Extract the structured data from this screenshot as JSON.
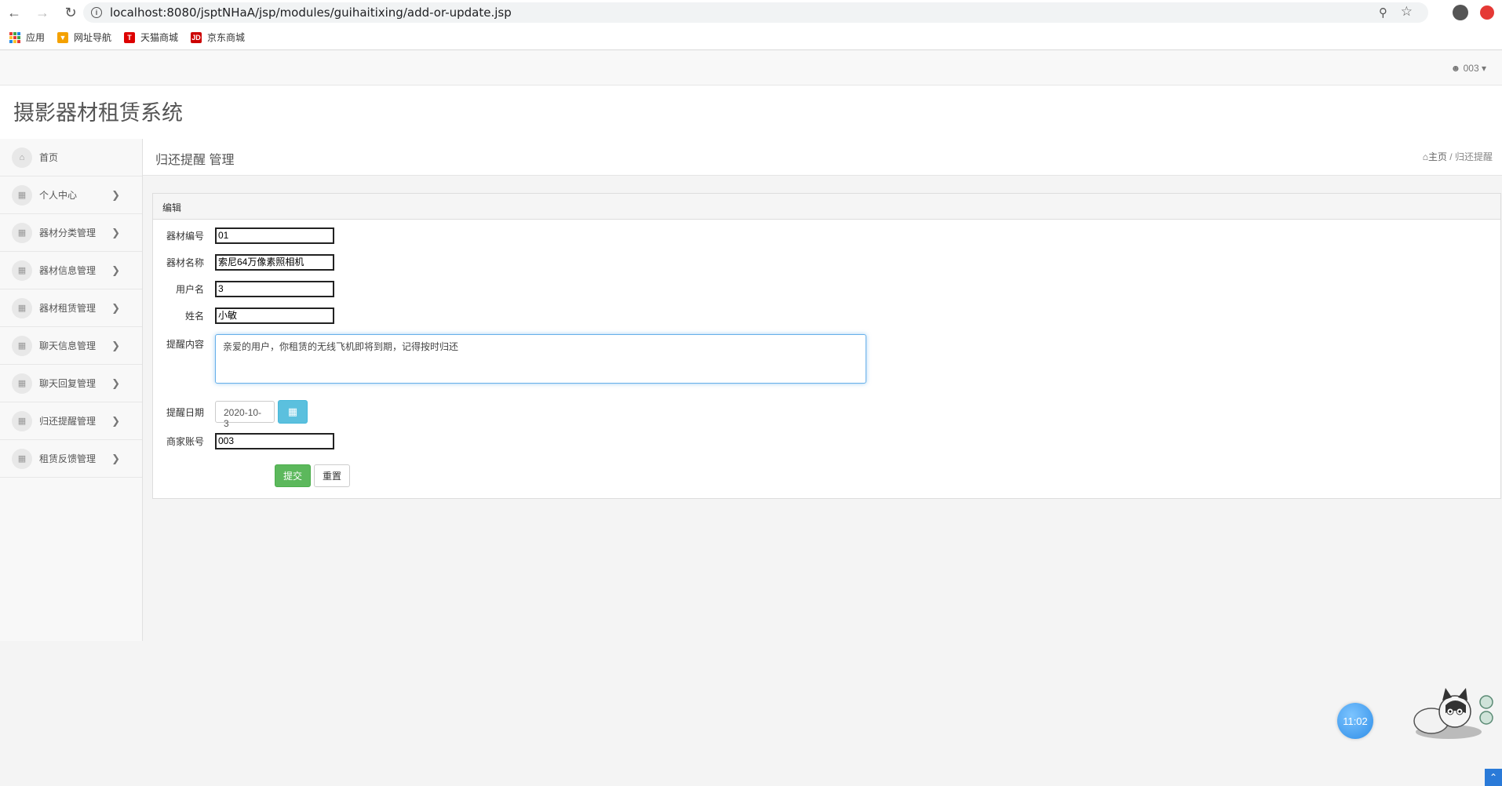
{
  "browser": {
    "url": "localhost:8080/jsptNHaA/jsp/modules/guihaitixing/add-or-update.jsp",
    "bookmarks": [
      {
        "label": "应用",
        "icon": "apps-grid-icon"
      },
      {
        "label": "网址导航",
        "icon": "nav-bookmark-icon",
        "color": "#f4a100"
      },
      {
        "label": "天猫商城",
        "icon": "tmall-icon",
        "color": "#d00"
      },
      {
        "label": "京东商城",
        "icon": "jd-icon",
        "color": "#c00"
      }
    ]
  },
  "header": {
    "user": "003",
    "app_title": "摄影器材租赁系统"
  },
  "sidebar": {
    "items": [
      {
        "label": "首页",
        "icon": "home-icon",
        "has_arrow": false
      },
      {
        "label": "个人中心",
        "icon": "table-icon",
        "has_arrow": true
      },
      {
        "label": "器材分类管理",
        "icon": "table-icon",
        "has_arrow": true
      },
      {
        "label": "器材信息管理",
        "icon": "table-icon",
        "has_arrow": true
      },
      {
        "label": "器材租赁管理",
        "icon": "table-icon",
        "has_arrow": true
      },
      {
        "label": "聊天信息管理",
        "icon": "table-icon",
        "has_arrow": true
      },
      {
        "label": "聊天回复管理",
        "icon": "table-icon",
        "has_arrow": true
      },
      {
        "label": "归还提醒管理",
        "icon": "table-icon",
        "has_arrow": true
      },
      {
        "label": "租赁反馈管理",
        "icon": "table-icon",
        "has_arrow": true
      }
    ]
  },
  "page": {
    "title": "归还提醒 管理",
    "breadcrumb_home": "主页",
    "breadcrumb_separator": "/",
    "breadcrumb_current": "归还提醒"
  },
  "form": {
    "panel_title": "编辑",
    "fields": {
      "equipment_no": {
        "label": "器材编号",
        "value": "01"
      },
      "equipment_name": {
        "label": "器材名称",
        "value": "索尼64万像素照相机"
      },
      "username": {
        "label": "用户名",
        "value": "3"
      },
      "name": {
        "label": "姓名",
        "value": "小敏"
      },
      "content": {
        "label": "提醒内容",
        "value": "亲爱的用户，你租赁的无线飞机即将到期，记得按时归还"
      },
      "date": {
        "label": "提醒日期",
        "value": "2020-10-3"
      },
      "merchant": {
        "label": "商家账号",
        "value": "003"
      }
    },
    "submit_label": "提交",
    "reset_label": "重置"
  },
  "widgets": {
    "clock": "11:02"
  }
}
